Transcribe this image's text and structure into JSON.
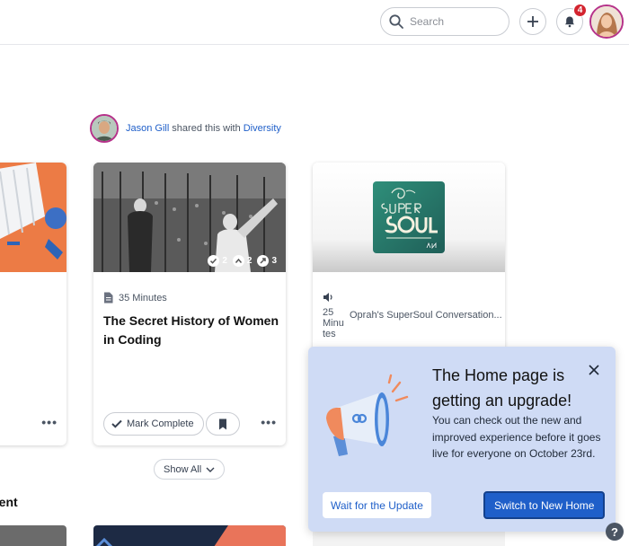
{
  "header": {
    "search_placeholder": "Search",
    "notification_count": "4"
  },
  "shared": {
    "user": "Jason Gill",
    "text": "shared this with",
    "group": "Diversity"
  },
  "cards": [
    {
      "meta": "35 Minutes",
      "title": "The Secret History of Women in Coding",
      "stats": {
        "completions": "2",
        "shares": "2",
        "recommendations": "3"
      },
      "mark_complete": "Mark Complete"
    },
    {
      "duration": "25 Minu tes",
      "title": "Oprah's SuperSoul Conversation..."
    }
  ],
  "show_all": "Show All",
  "section_title_partial": "tent",
  "popup": {
    "title": "The Home page is getting an upgrade!",
    "body": "You can check out the new and improved experience before it goes live for everyone on October 23rd.",
    "wait_label": "Wait for the Update",
    "switch_label": "Switch to New Home"
  },
  "help_label": "?",
  "colors": {
    "accent": "#1f5fc9",
    "popup_bg": "#cfdbf5",
    "badge": "#d3242f",
    "avatar_ring": "#b6328a"
  },
  "icons": [
    "search-icon",
    "plus-icon",
    "bell-icon",
    "document-icon",
    "audio-icon",
    "check-icon",
    "bookmark-icon",
    "chevron-down-icon",
    "close-icon",
    "megaphone-icon",
    "help-icon"
  ]
}
